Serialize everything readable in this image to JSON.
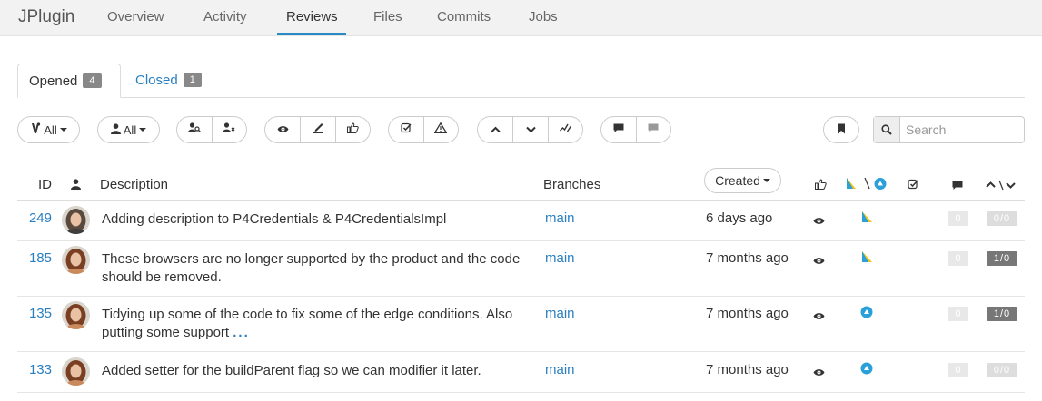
{
  "app": {
    "brand": "JPlugin",
    "nav_tabs": [
      "Overview",
      "Activity",
      "Reviews",
      "Files",
      "Commits",
      "Jobs"
    ],
    "active_tab": "Reviews"
  },
  "subtabs": {
    "opened": {
      "label": "Opened",
      "count": "4"
    },
    "closed": {
      "label": "Closed",
      "count": "1"
    }
  },
  "filters": {
    "project_filter": "All",
    "user_filter": "All",
    "search_placeholder": "Search"
  },
  "table": {
    "headers": {
      "id": "ID",
      "description": "Description",
      "branches": "Branches",
      "created_sort": "Created"
    },
    "rows": [
      {
        "id": "249",
        "description": "Adding description to P4Credentials & P4CredentialsImpl",
        "ellipsis": "",
        "branch": "main",
        "created": "6 days ago",
        "state": "needs-review",
        "comments": "0",
        "counts": "0/0",
        "counts_style": "light"
      },
      {
        "id": "185",
        "description": "These browsers are no longer supported by the product and the code should be removed.",
        "ellipsis": "",
        "branch": "main",
        "created": "7 months ago",
        "state": "needs-review",
        "comments": "0",
        "counts": "1/0",
        "counts_style": "dark"
      },
      {
        "id": "135",
        "description": "Tidying up some of the code to fix some of the edge conditions. Also putting some support",
        "ellipsis": "...",
        "branch": "main",
        "created": "7 months ago",
        "state": "needs-revision",
        "comments": "0",
        "counts": "1/0",
        "counts_style": "dark"
      },
      {
        "id": "133",
        "description": "Added setter for the buildParent flag so we can modifier it later.",
        "ellipsis": "",
        "branch": "main",
        "created": "7 months ago",
        "state": "needs-revision",
        "comments": "0",
        "counts": "0/0",
        "counts_style": "light"
      }
    ]
  },
  "colors": {
    "accent": "#2a8ac4",
    "link": "#2a7fc0",
    "state_blue": "#2aa0d8",
    "state_yellow": "#f0c419"
  }
}
